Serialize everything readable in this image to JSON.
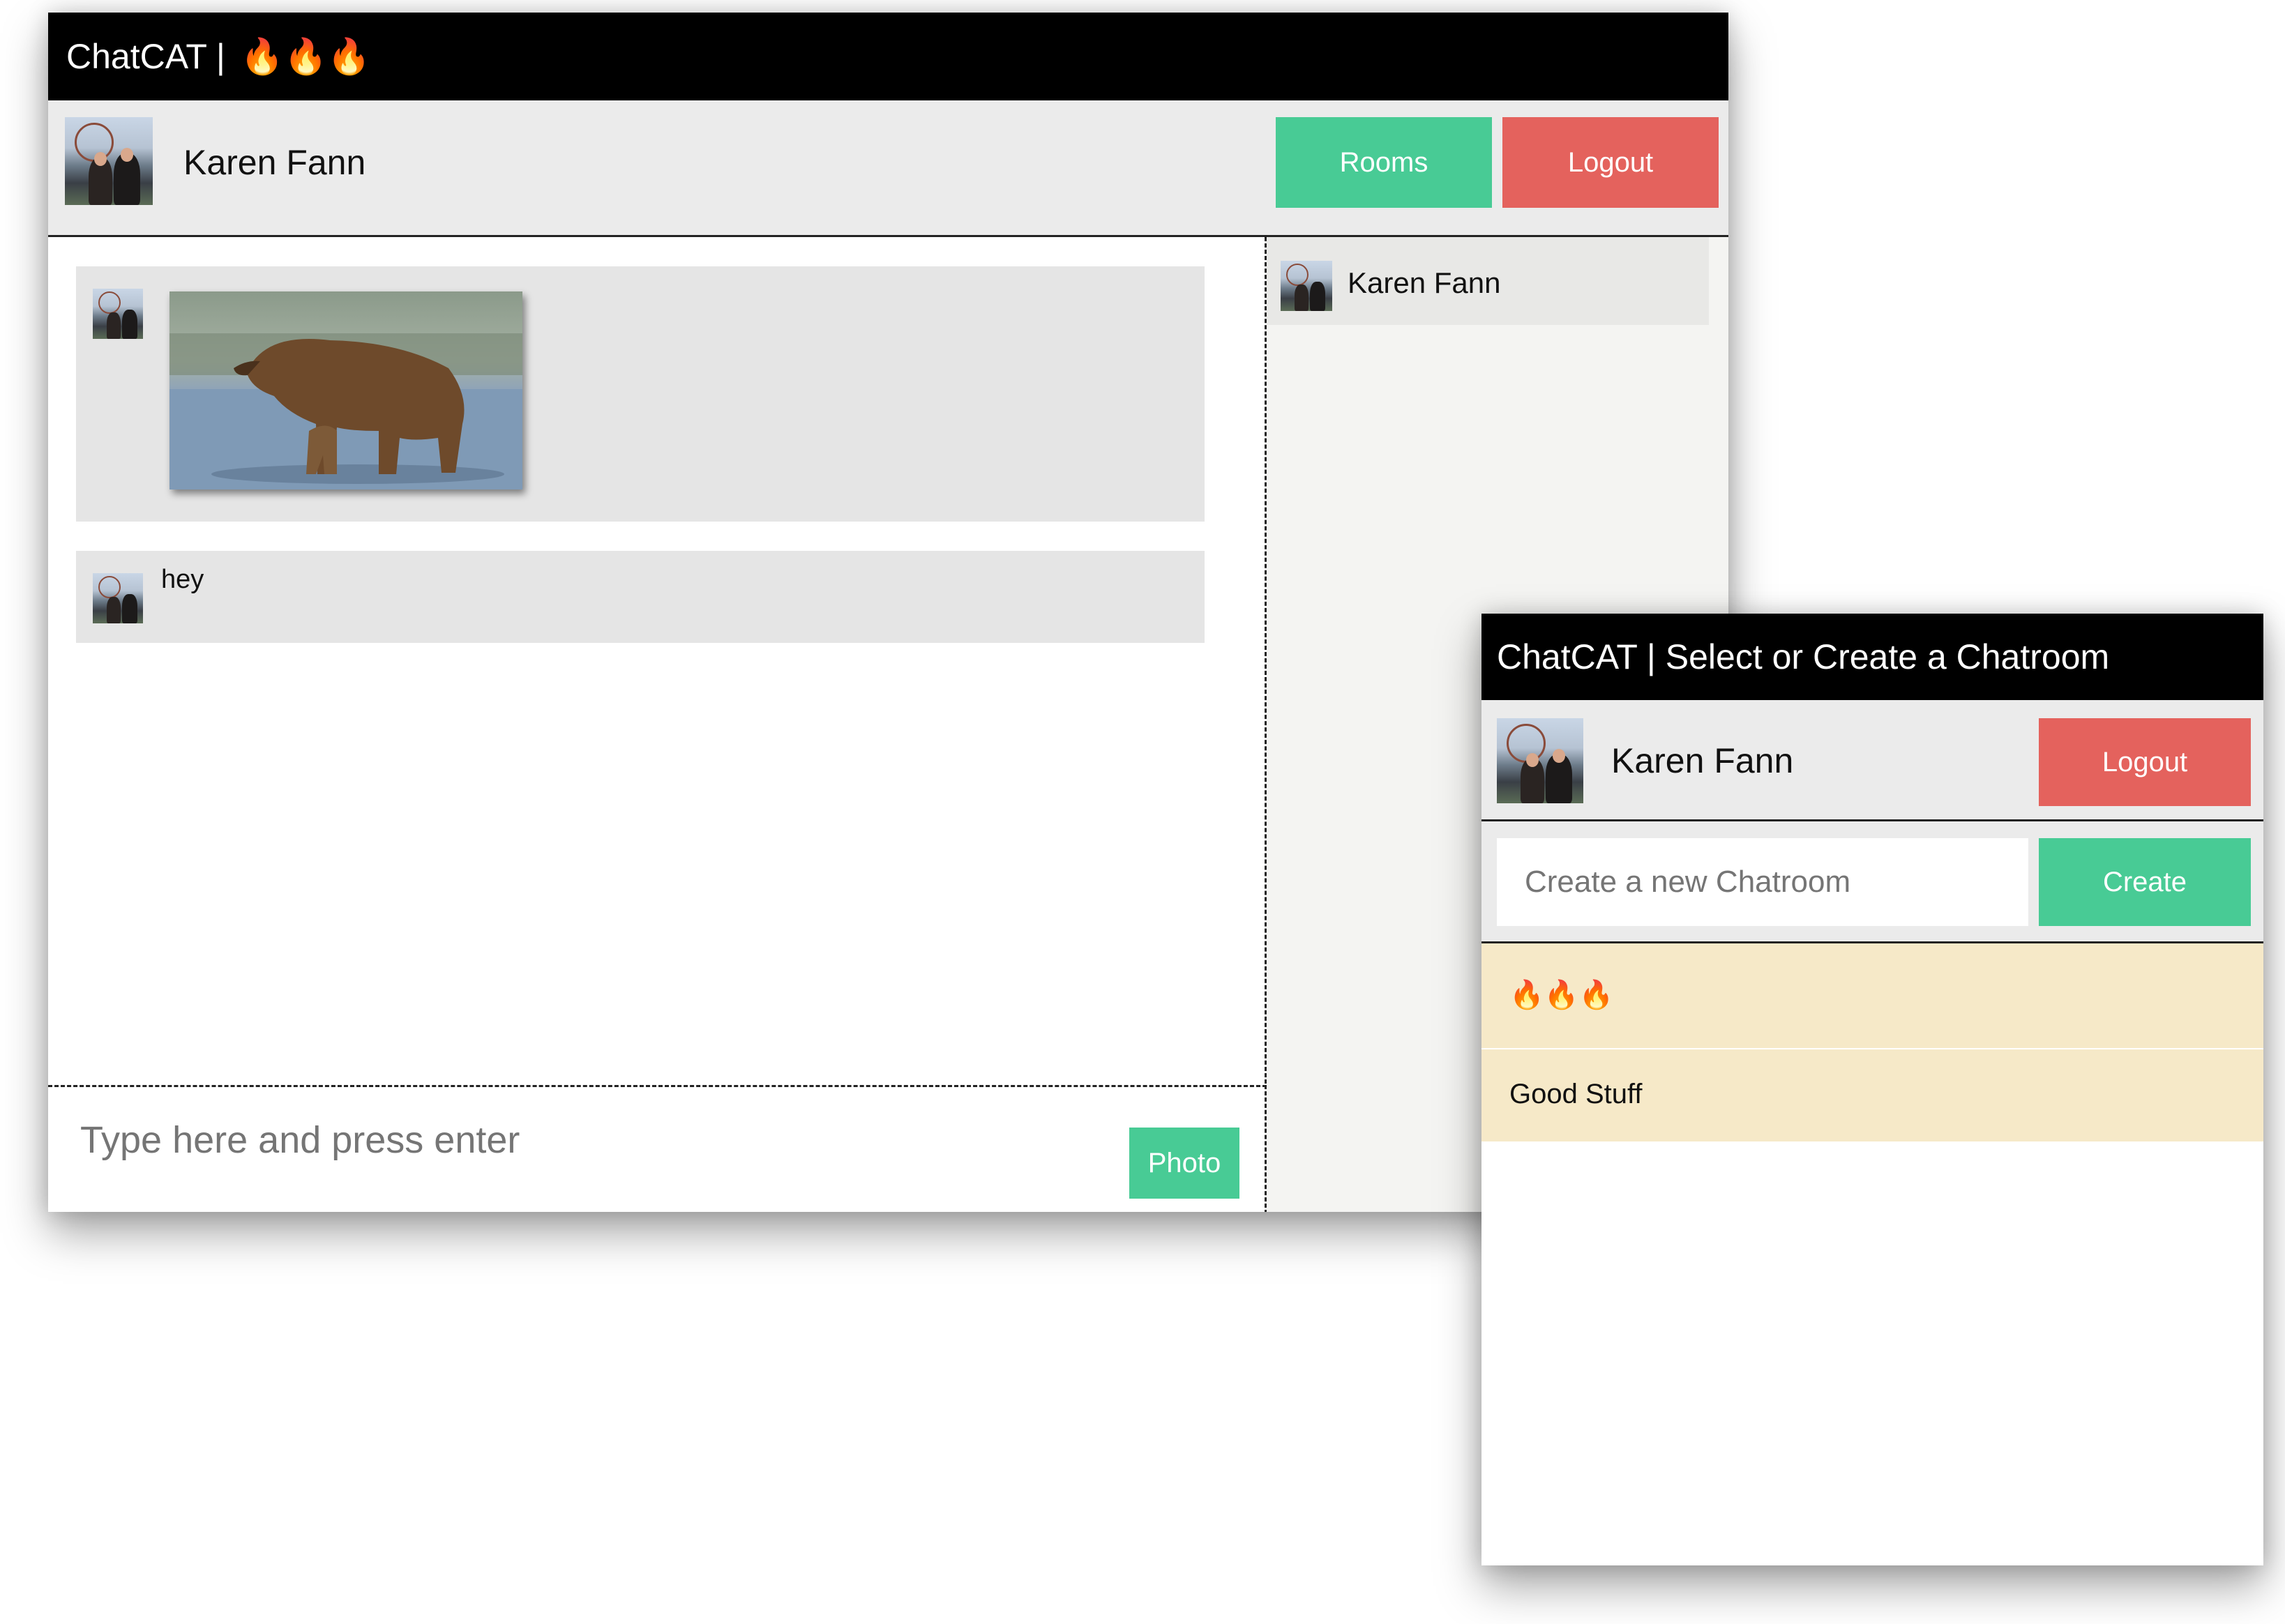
{
  "chat_window": {
    "title_prefix": "ChatCAT | ",
    "title_room": "🔥🔥🔥",
    "user_name": "Karen Fann",
    "rooms_button": "Rooms",
    "logout_button": "Logout",
    "messages": [
      {
        "type": "image",
        "image_desc": "bear"
      },
      {
        "type": "text",
        "text": "hey"
      }
    ],
    "input_placeholder": "Type here and press enter",
    "photo_button": "Photo",
    "online_users": [
      {
        "name": "Karen Fann"
      }
    ]
  },
  "rooms_window": {
    "title": "ChatCAT | Select or Create a Chatroom",
    "user_name": "Karen Fann",
    "logout_button": "Logout",
    "create_placeholder": "Create a new Chatroom",
    "create_button": "Create",
    "rooms": [
      {
        "name": "🔥🔥🔥"
      },
      {
        "name": "Good Stuff"
      }
    ]
  },
  "colors": {
    "accent_green": "#48cb95",
    "accent_red": "#e4625d",
    "room_item_bg": "#f6e9c8"
  }
}
